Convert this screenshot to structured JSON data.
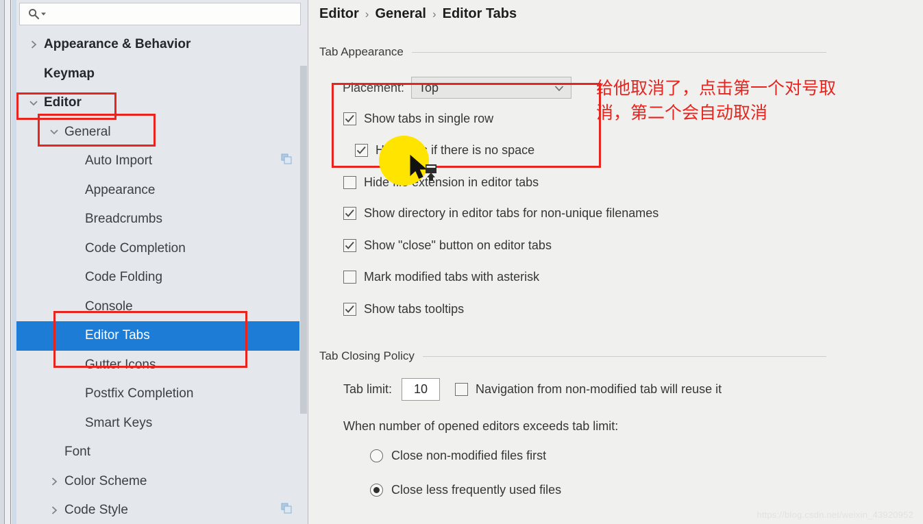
{
  "colors": {
    "accent_selection": "#1C7CD6",
    "sidebar_bg": "#E4E8ED",
    "main_bg": "#F0F0EE",
    "annotation_red": "#E8241F",
    "highlight_yellow": "#FFE400"
  },
  "search": {
    "placeholder": "",
    "value": "",
    "icon": "search-icon"
  },
  "sidebar": {
    "items": [
      {
        "label": "Appearance & Behavior",
        "arrow": "chevron-right-icon",
        "indent": 0,
        "bold": true,
        "selected": false,
        "badge": false
      },
      {
        "label": "Keymap",
        "arrow": "",
        "indent": 0,
        "bold": true,
        "selected": false,
        "badge": false
      },
      {
        "label": "Editor",
        "arrow": "chevron-down-icon",
        "indent": 0,
        "bold": true,
        "selected": false,
        "badge": false
      },
      {
        "label": "General",
        "arrow": "chevron-down-icon",
        "indent": 1,
        "bold": false,
        "selected": false,
        "badge": false
      },
      {
        "label": "Auto Import",
        "arrow": "",
        "indent": 2,
        "bold": false,
        "selected": false,
        "badge": true
      },
      {
        "label": "Appearance",
        "arrow": "",
        "indent": 2,
        "bold": false,
        "selected": false,
        "badge": false
      },
      {
        "label": "Breadcrumbs",
        "arrow": "",
        "indent": 2,
        "bold": false,
        "selected": false,
        "badge": false
      },
      {
        "label": "Code Completion",
        "arrow": "",
        "indent": 2,
        "bold": false,
        "selected": false,
        "badge": false
      },
      {
        "label": "Code Folding",
        "arrow": "",
        "indent": 2,
        "bold": false,
        "selected": false,
        "badge": false
      },
      {
        "label": "Console",
        "arrow": "",
        "indent": 2,
        "bold": false,
        "selected": false,
        "badge": false
      },
      {
        "label": "Editor Tabs",
        "arrow": "",
        "indent": 2,
        "bold": false,
        "selected": true,
        "badge": false
      },
      {
        "label": "Gutter Icons",
        "arrow": "",
        "indent": 2,
        "bold": false,
        "selected": false,
        "badge": false
      },
      {
        "label": "Postfix Completion",
        "arrow": "",
        "indent": 2,
        "bold": false,
        "selected": false,
        "badge": false
      },
      {
        "label": "Smart Keys",
        "arrow": "",
        "indent": 2,
        "bold": false,
        "selected": false,
        "badge": false
      },
      {
        "label": "Font",
        "arrow": "",
        "indent": 1,
        "bold": false,
        "selected": false,
        "badge": false
      },
      {
        "label": "Color Scheme",
        "arrow": "chevron-right-icon",
        "indent": 1,
        "bold": false,
        "selected": false,
        "badge": false
      },
      {
        "label": "Code Style",
        "arrow": "chevron-right-icon",
        "indent": 1,
        "bold": false,
        "selected": false,
        "badge": true
      }
    ]
  },
  "breadcrumb": {
    "items": [
      "Editor",
      "General",
      "Editor Tabs"
    ],
    "separator": "›"
  },
  "main": {
    "group_tab_appearance": "Tab Appearance",
    "group_tab_closing": "Tab Closing Policy",
    "placement": {
      "label": "Placement:",
      "value": "Top",
      "chevron": "chevron-down-icon"
    },
    "checkboxes": [
      {
        "label": "Show tabs in single row",
        "checked": true,
        "indent": 0
      },
      {
        "label": "Hide tabs if there is no space",
        "checked": true,
        "indent": 1
      },
      {
        "label": "Hide file extension in editor tabs",
        "checked": false,
        "indent": 0
      },
      {
        "label": "Show directory in editor tabs for non-unique filenames",
        "checked": true,
        "indent": 0
      },
      {
        "label": "Show \"close\" button on editor tabs",
        "checked": true,
        "indent": 0
      },
      {
        "label": "Mark modified tabs with asterisk",
        "checked": false,
        "indent": 0
      },
      {
        "label": "Show tabs tooltips",
        "checked": true,
        "indent": 0
      }
    ],
    "tab_limit": {
      "label": "Tab limit:",
      "value": "10"
    },
    "reuse_checkbox": {
      "label": "Navigation from non-modified tab will reuse it",
      "checked": false
    },
    "exceeds_label": "When number of opened editors exceeds tab limit:",
    "radios": [
      {
        "label": "Close non-modified files first",
        "selected": false
      },
      {
        "label": "Close less frequently used files",
        "selected": true
      }
    ]
  },
  "annotation": {
    "line1": "给他取消了，点击第一个对号取",
    "line2": "消，第二个会自动取消"
  },
  "watermark": "https://blog.csdn.net/weixin_43920952"
}
